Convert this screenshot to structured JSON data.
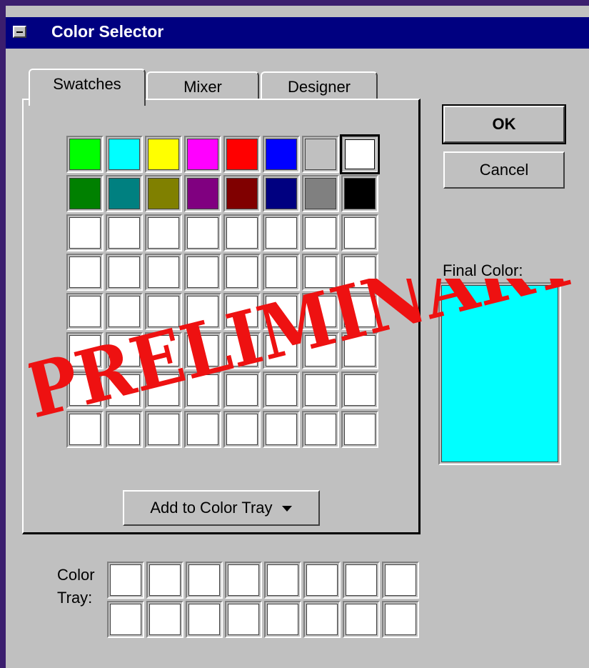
{
  "window": {
    "title": "Color Selector"
  },
  "tabs": [
    {
      "label": "Swatches",
      "active": true
    },
    {
      "label": "Mixer",
      "active": false
    },
    {
      "label": "Designer",
      "active": false
    }
  ],
  "buttons": {
    "ok": "OK",
    "cancel": "Cancel",
    "add_to_tray": "Add to Color Tray"
  },
  "swatches": {
    "rows": [
      [
        "#00ff00",
        "#00ffff",
        "#ffff00",
        "#ff00ff",
        "#ff0000",
        "#0000ff",
        "#c0c0c0",
        "#ffffff"
      ],
      [
        "#008000",
        "#008080",
        "#808000",
        "#800080",
        "#800000",
        "#000080",
        "#808080",
        "#000000"
      ],
      [
        "#ffffff",
        "#ffffff",
        "#ffffff",
        "#ffffff",
        "#ffffff",
        "#ffffff",
        "#ffffff",
        "#ffffff"
      ],
      [
        "#ffffff",
        "#ffffff",
        "#ffffff",
        "#ffffff",
        "#ffffff",
        "#ffffff",
        "#ffffff",
        "#ffffff"
      ],
      [
        "#ffffff",
        "#ffffff",
        "#ffffff",
        "#ffffff",
        "#ffffff",
        "#ffffff",
        "#ffffff",
        "#ffffff"
      ],
      [
        "#ffffff",
        "#ffffff",
        "#ffffff",
        "#ffffff",
        "#ffffff",
        "#ffffff",
        "#ffffff",
        "#ffffff"
      ],
      [
        "#ffffff",
        "#ffffff",
        "#ffffff",
        "#ffffff",
        "#ffffff",
        "#ffffff",
        "#ffffff",
        "#ffffff"
      ],
      [
        "#ffffff",
        "#ffffff",
        "#ffffff",
        "#ffffff",
        "#ffffff",
        "#ffffff",
        "#ffffff",
        "#ffffff"
      ]
    ],
    "selected_row": 0,
    "selected_col": 7
  },
  "final_color": {
    "label": "Final Color:",
    "value": "#00ffff"
  },
  "color_tray": {
    "label_line1": "Color",
    "label_line2": "Tray:",
    "rows": [
      [
        "#ffffff",
        "#ffffff",
        "#ffffff",
        "#ffffff",
        "#ffffff",
        "#ffffff",
        "#ffffff",
        "#ffffff"
      ],
      [
        "#ffffff",
        "#ffffff",
        "#ffffff",
        "#ffffff",
        "#ffffff",
        "#ffffff",
        "#ffffff",
        "#ffffff"
      ]
    ]
  },
  "watermark": {
    "text": "PRELIMINARY",
    "color": "#ee1111"
  },
  "icons": {
    "system_menu": "minus-box-icon",
    "dropdown": "caret-down-icon"
  }
}
